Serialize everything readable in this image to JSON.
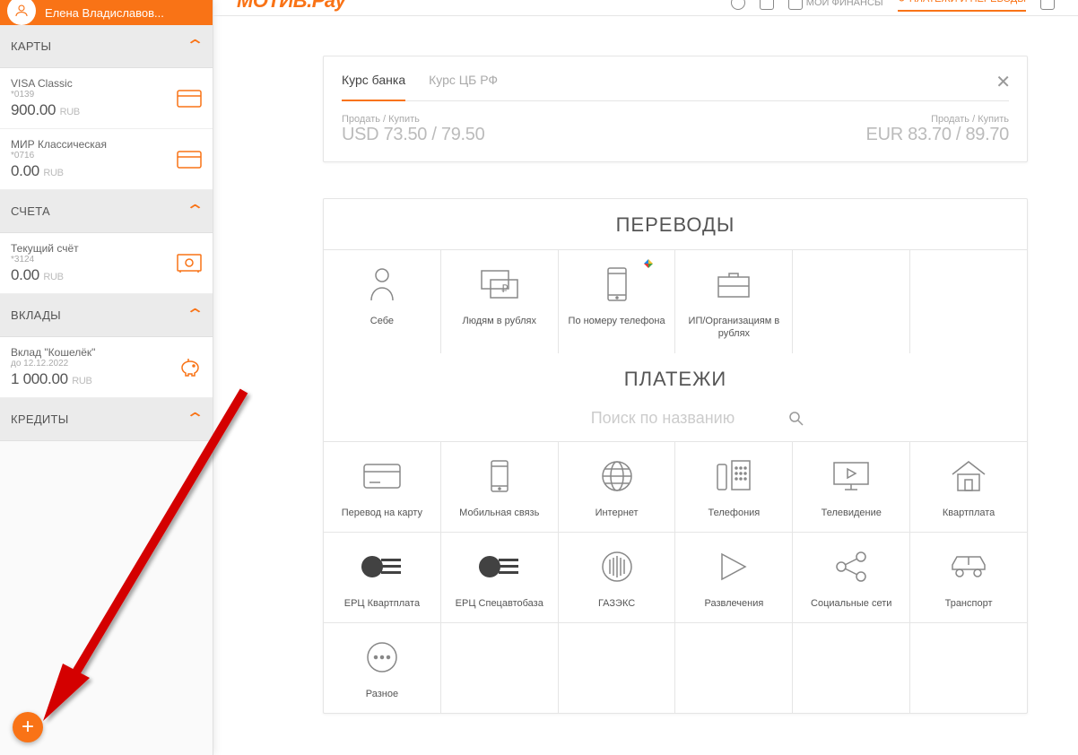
{
  "header": {
    "logo": "МОТИВ.Pay",
    "user_name": "Елена Владиславов...",
    "nav_finances": "МОИ ФИНАНСЫ",
    "nav_payments": "ПЛАТЕЖИ И ПЕРЕВОДЫ"
  },
  "sidebar": {
    "sections": {
      "cards": {
        "title": "КАРТЫ",
        "items": [
          {
            "title": "VISA Classic",
            "sub": "*0139",
            "balance": "900.00",
            "currency": "RUB"
          },
          {
            "title": "МИР Классическая",
            "sub": "*0716",
            "balance": "0.00",
            "currency": "RUB"
          }
        ]
      },
      "accounts": {
        "title": "СЧЕТА",
        "items": [
          {
            "title": "Текущий счёт",
            "sub": "*3124",
            "balance": "0.00",
            "currency": "RUB"
          }
        ]
      },
      "deposits": {
        "title": "ВКЛАДЫ",
        "items": [
          {
            "title": "Вклад \"Кошелёк\"",
            "sub": "до 12.12.2022",
            "balance": "1 000.00",
            "currency": "RUB"
          }
        ]
      },
      "credits": {
        "title": "КРЕДИТЫ"
      }
    }
  },
  "rates": {
    "tab_bank": "Курс банка",
    "tab_cbrf": "Курс ЦБ РФ",
    "label": "Продать / Купить",
    "usd": "USD 73.50 / 79.50",
    "eur": "EUR 83.70 / 89.70"
  },
  "transfers": {
    "title": "ПЕРЕВОДЫ",
    "items": [
      "Себе",
      "Людям в рублях",
      "По номеру телефона",
      "ИП/Организациям в рублях"
    ]
  },
  "payments": {
    "title": "ПЛАТЕЖИ",
    "search_placeholder": "Поиск по названию",
    "items": [
      "Перевод на карту",
      "Мобильная связь",
      "Интернет",
      "Телефония",
      "Телевидение",
      "Квартплата",
      "ЕРЦ Квартплата",
      "ЕРЦ Спецавтобаза",
      "ГАЗЭКС",
      "Развлечения",
      "Социальные сети",
      "Транспорт",
      "Разное"
    ]
  }
}
